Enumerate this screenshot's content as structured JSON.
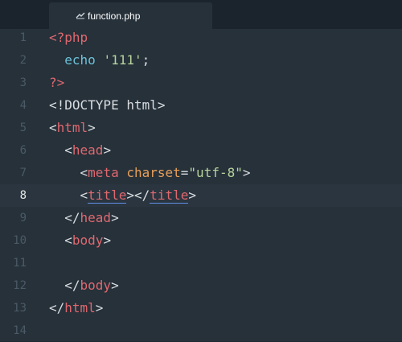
{
  "tab": {
    "label": "function.php",
    "icon": "php-file-icon"
  },
  "active_line": 8,
  "lines": [
    {
      "n": "1",
      "tokens": [
        {
          "t": "<?php",
          "c": "t-php"
        }
      ]
    },
    {
      "n": "2",
      "tokens": [
        {
          "t": "  ",
          "c": "t-plain"
        },
        {
          "t": "echo",
          "c": "t-kw"
        },
        {
          "t": " ",
          "c": "t-plain"
        },
        {
          "t": "'111'",
          "c": "t-str"
        },
        {
          "t": ";",
          "c": "t-plain"
        }
      ]
    },
    {
      "n": "3",
      "tokens": [
        {
          "t": "?>",
          "c": "t-php"
        }
      ]
    },
    {
      "n": "4",
      "tokens": [
        {
          "t": "<!DOCTYPE html>",
          "c": "t-plain"
        }
      ]
    },
    {
      "n": "5",
      "tokens": [
        {
          "t": "<",
          "c": "t-plain"
        },
        {
          "t": "html",
          "c": "t-tag"
        },
        {
          "t": ">",
          "c": "t-plain"
        }
      ]
    },
    {
      "n": "6",
      "tokens": [
        {
          "t": "  <",
          "c": "t-plain"
        },
        {
          "t": "head",
          "c": "t-tag"
        },
        {
          "t": ">",
          "c": "t-plain"
        }
      ]
    },
    {
      "n": "7",
      "tokens": [
        {
          "t": "    <",
          "c": "t-plain"
        },
        {
          "t": "meta",
          "c": "t-tag"
        },
        {
          "t": " ",
          "c": "t-plain"
        },
        {
          "t": "charset",
          "c": "t-attr"
        },
        {
          "t": "=",
          "c": "t-plain"
        },
        {
          "t": "\"utf-8\"",
          "c": "t-str"
        },
        {
          "t": ">",
          "c": "t-plain"
        }
      ]
    },
    {
      "n": "8",
      "tokens": [
        {
          "t": "    <",
          "c": "t-plain"
        },
        {
          "t": "title",
          "c": "t-tag t-match"
        },
        {
          "t": "></",
          "c": "t-plain"
        },
        {
          "t": "title",
          "c": "t-tag t-match"
        },
        {
          "t": ">",
          "c": "t-plain"
        }
      ]
    },
    {
      "n": "9",
      "tokens": [
        {
          "t": "  </",
          "c": "t-plain"
        },
        {
          "t": "head",
          "c": "t-tag"
        },
        {
          "t": ">",
          "c": "t-plain"
        }
      ]
    },
    {
      "n": "10",
      "tokens": [
        {
          "t": "  <",
          "c": "t-plain"
        },
        {
          "t": "body",
          "c": "t-tag"
        },
        {
          "t": ">",
          "c": "t-plain"
        }
      ]
    },
    {
      "n": "11",
      "tokens": []
    },
    {
      "n": "12",
      "tokens": [
        {
          "t": "  </",
          "c": "t-plain"
        },
        {
          "t": "body",
          "c": "t-tag"
        },
        {
          "t": ">",
          "c": "t-plain"
        }
      ]
    },
    {
      "n": "13",
      "tokens": [
        {
          "t": "</",
          "c": "t-plain"
        },
        {
          "t": "html",
          "c": "t-tag"
        },
        {
          "t": ">",
          "c": "t-plain"
        }
      ]
    },
    {
      "n": "14",
      "tokens": []
    }
  ]
}
